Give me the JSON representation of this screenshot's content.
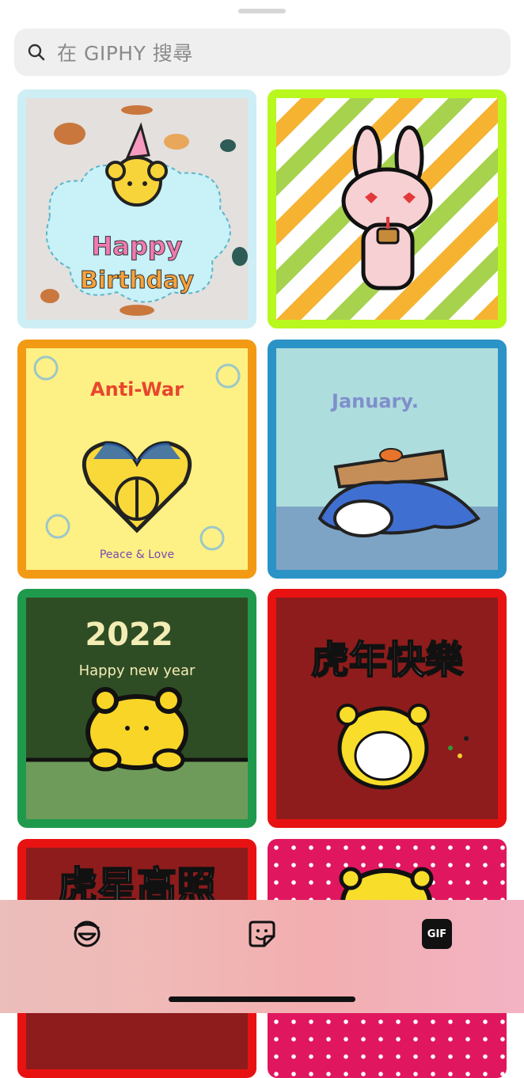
{
  "search": {
    "placeholder": "在 GIPHY 搜尋"
  },
  "stickers": [
    {
      "name": "happy-birthday-bear",
      "text_line1": "Happy",
      "text_line2": "Birthday",
      "border": "#cdeef5"
    },
    {
      "name": "bunny-with-cake",
      "border": "#b8f81e"
    },
    {
      "name": "anti-war-peace-love",
      "title": "Anti-War",
      "caption": "Peace & Love",
      "border": "#f39a14"
    },
    {
      "name": "january-kotatsu-cat",
      "title": "January.",
      "border": "#2b93c6"
    },
    {
      "name": "2022-tiger",
      "year": "2022",
      "subtitle": "Happy new year",
      "border": "#1f9a4c"
    },
    {
      "name": "tiger-year-happy",
      "title": "虎年快樂",
      "border": "#e81212"
    },
    {
      "name": "tiger-star-shines",
      "title": "虎星高照",
      "border": "#e81212"
    },
    {
      "name": "polka-dot-tiger",
      "border": "#f7f0f4"
    }
  ],
  "tabs": [
    {
      "name": "emoji-tab",
      "icon": "emoji-icon"
    },
    {
      "name": "sticker-tab",
      "icon": "sticker-icon"
    },
    {
      "name": "gif-tab",
      "icon": "gif-icon",
      "label": "GIF"
    }
  ],
  "colors": {
    "search_bg": "#efefef",
    "bottom_bar_start": "#ebbdbb",
    "bottom_bar_end": "#f3b3c3"
  }
}
